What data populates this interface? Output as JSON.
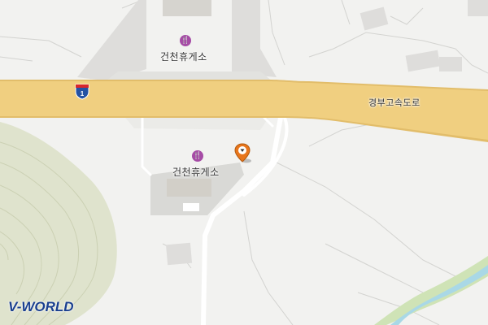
{
  "map": {
    "colors": {
      "background": "#f2f2f0",
      "highway": "#f0cf80",
      "highway_edge": "#e2bd6a",
      "parking": "#d9d9d6",
      "road": "#ffffff",
      "hill": "#dfe3cd",
      "river": "#a9d8e6",
      "river_bank": "#cfe3b6",
      "poi": "#a64ca6",
      "pin": "#e8761c"
    },
    "labels": {
      "rest_area_north": "건천휴게소",
      "rest_area_south": "건천휴게소",
      "expressway": "경부고속도로"
    },
    "route_shield": {
      "number": "1",
      "icon": "expressway-shield-icon"
    },
    "poi_icon": "restaurant-icon",
    "marker_icon": "location-pin-icon",
    "brand": "V-WORLD"
  }
}
